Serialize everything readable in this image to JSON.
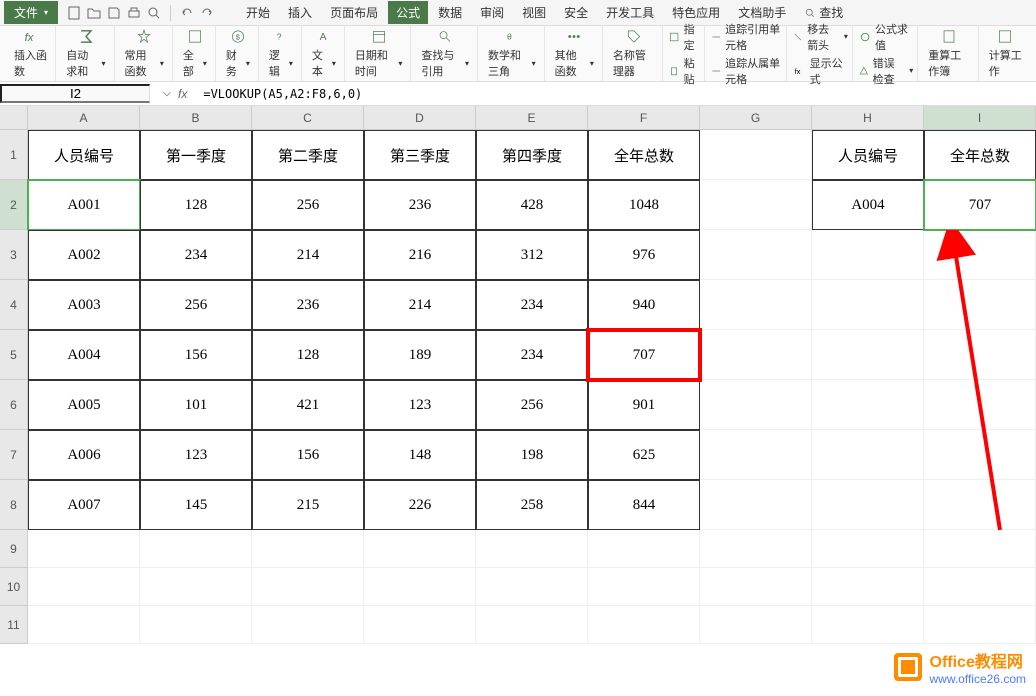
{
  "menubar": {
    "file": "文件",
    "tabs": [
      "开始",
      "插入",
      "页面布局",
      "公式",
      "数据",
      "审阅",
      "视图",
      "安全",
      "开发工具",
      "特色应用",
      "文档助手"
    ],
    "active_tab": "公式",
    "search": "查找"
  },
  "ribbon": {
    "insert_fn": "插入函数",
    "autosum": "自动求和",
    "common": "常用函数",
    "all": "全部",
    "finance": "财务",
    "logic": "逻辑",
    "text": "文本",
    "datetime": "日期和时间",
    "lookup": "查找与引用",
    "math": "数学和三角",
    "other": "其他函数",
    "name_mgr": "名称管理器",
    "paste": "粘贴",
    "trace_prec": "追踪引用单元格",
    "trace_dep": "追踪从属单元格",
    "remove_arrows": "移去箭头",
    "show_formula": "显示公式",
    "formula_eval": "公式求值",
    "error_check": "错误检查",
    "recalc": "重算工作簿",
    "calc_sheet": "计算工作",
    "specify": "指定"
  },
  "formula_bar": {
    "name_box": "I2",
    "formula": "=VLOOKUP(A5,A2:F8,6,0)"
  },
  "columns": [
    "A",
    "B",
    "C",
    "D",
    "E",
    "F",
    "G",
    "H",
    "I"
  ],
  "row_numbers": [
    "1",
    "2",
    "3",
    "4",
    "5",
    "6",
    "7",
    "8",
    "9",
    "10",
    "11"
  ],
  "table": {
    "headers": [
      "人员编号",
      "第一季度",
      "第二季度",
      "第三季度",
      "第四季度",
      "全年总数"
    ],
    "rows": [
      [
        "A001",
        "128",
        "256",
        "236",
        "428",
        "1048"
      ],
      [
        "A002",
        "234",
        "214",
        "216",
        "312",
        "976"
      ],
      [
        "A003",
        "256",
        "236",
        "214",
        "234",
        "940"
      ],
      [
        "A004",
        "156",
        "128",
        "189",
        "234",
        "707"
      ],
      [
        "A005",
        "101",
        "421",
        "123",
        "256",
        "901"
      ],
      [
        "A006",
        "123",
        "156",
        "148",
        "198",
        "625"
      ],
      [
        "A007",
        "145",
        "215",
        "226",
        "258",
        "844"
      ]
    ]
  },
  "lookup": {
    "h1_label": "人员编号",
    "i1_label": "全年总数",
    "h2_value": "A004",
    "i2_value": "707"
  },
  "watermark": {
    "title": "Office教程网",
    "url": "www.office26.com"
  }
}
